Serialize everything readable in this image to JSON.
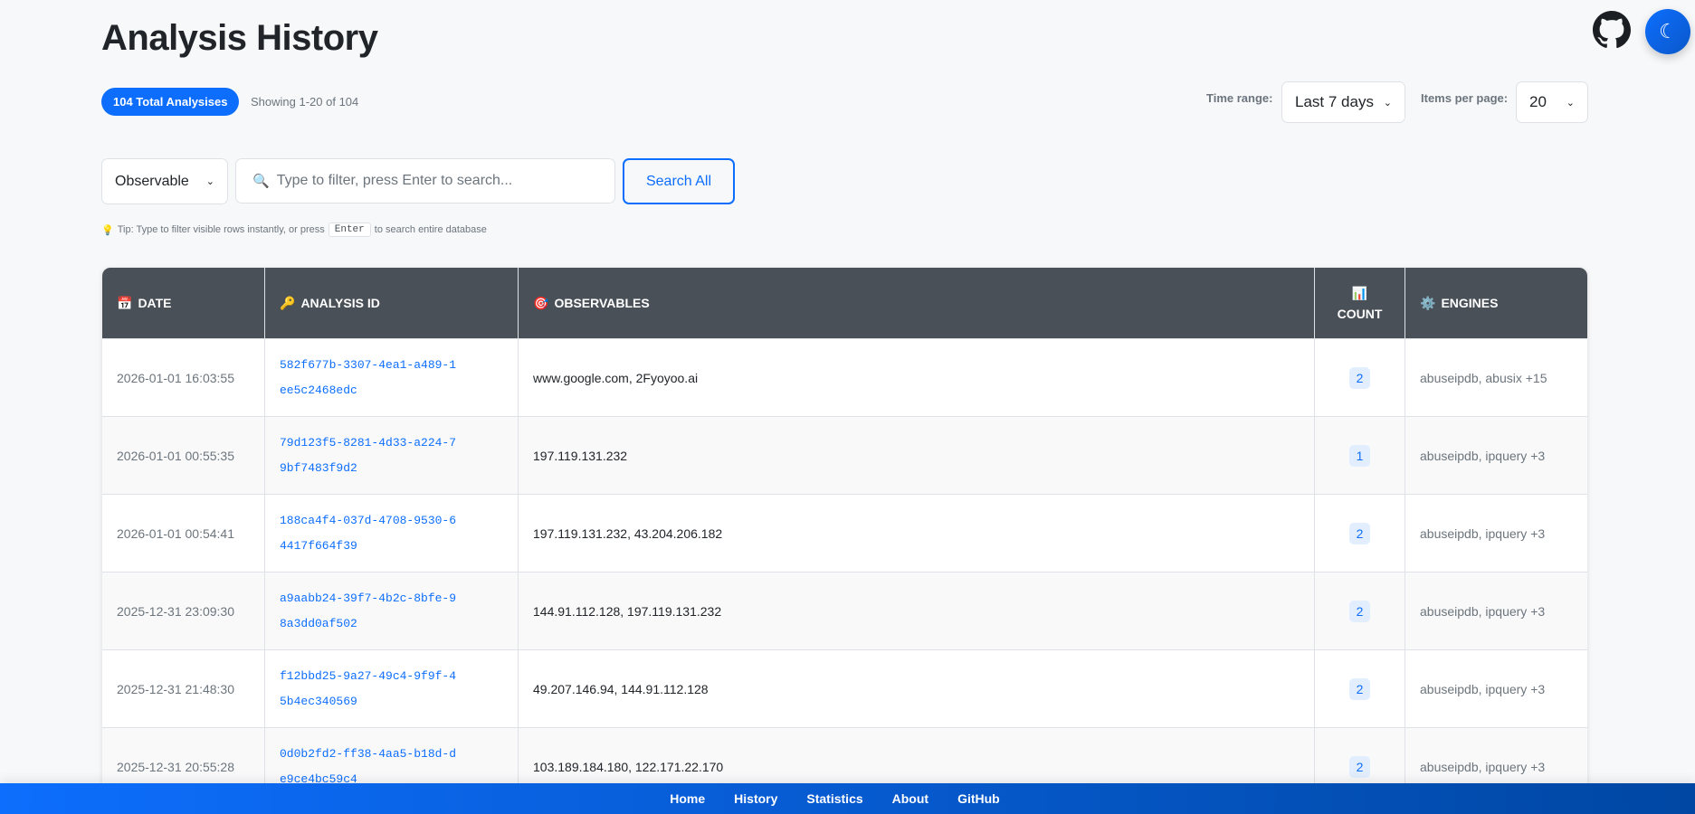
{
  "header": {
    "title": "Analysis History",
    "total_badge": "104 Total Analysises",
    "showing": "Showing 1-20 of 104"
  },
  "controls": {
    "time_range_label": "Time range:",
    "time_range_value": "Last 7 days",
    "items_per_page_label": "Items per page:",
    "items_per_page_value": "20"
  },
  "search": {
    "filter_type": "Observable",
    "placeholder": "Type to filter, press Enter to search...",
    "search_all": "Search All",
    "tip_prefix": "Tip: Type to filter visible rows instantly, or press",
    "tip_key": "Enter",
    "tip_suffix": "to search entire database"
  },
  "table": {
    "headers": {
      "date": "DATE",
      "id": "ANALYSIS ID",
      "observables": "OBSERVABLES",
      "count": "COUNT",
      "engines": "ENGINES"
    },
    "rows": [
      {
        "date": "2026-01-01 16:03:55",
        "id": "582f677b-3307-4ea1-a489-1ee5c2468edc",
        "observables": "www.google.com, 2Fyoyoo.ai",
        "count": "2",
        "engines": "abuseipdb, abusix +15"
      },
      {
        "date": "2026-01-01 00:55:35",
        "id": "79d123f5-8281-4d33-a224-79bf7483f9d2",
        "observables": "197.119.131.232",
        "count": "1",
        "engines": "abuseipdb, ipquery +3"
      },
      {
        "date": "2026-01-01 00:54:41",
        "id": "188ca4f4-037d-4708-9530-64417f664f39",
        "observables": "197.119.131.232, 43.204.206.182",
        "count": "2",
        "engines": "abuseipdb, ipquery +3"
      },
      {
        "date": "2025-12-31 23:09:30",
        "id": "a9aabb24-39f7-4b2c-8bfe-98a3dd0af502",
        "observables": "144.91.112.128, 197.119.131.232",
        "count": "2",
        "engines": "abuseipdb, ipquery +3"
      },
      {
        "date": "2025-12-31 21:48:30",
        "id": "f12bbd25-9a27-49c4-9f9f-45b4ec340569",
        "observables": "49.207.146.94, 144.91.112.128",
        "count": "2",
        "engines": "abuseipdb, ipquery +3"
      },
      {
        "date": "2025-12-31 20:55:28",
        "id": "0d0b2fd2-ff38-4aa5-b18d-de9ce4bc59c4",
        "observables": "103.189.184.180, 122.171.22.170",
        "count": "2",
        "engines": "abuseipdb, ipquery +3"
      }
    ]
  },
  "footer": {
    "links": [
      "Home",
      "History",
      "Statistics",
      "About",
      "GitHub"
    ]
  }
}
